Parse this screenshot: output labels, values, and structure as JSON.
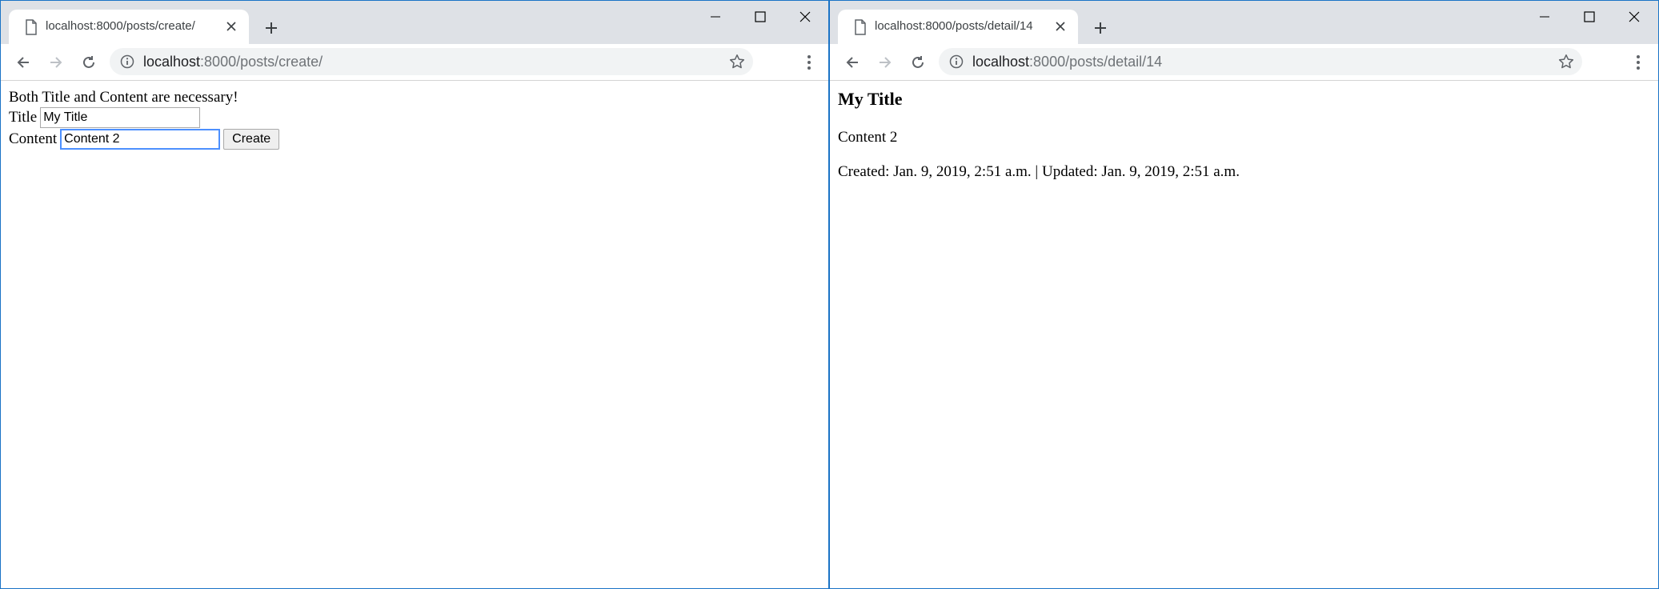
{
  "left": {
    "tab_title": "localhost:8000/posts/create/",
    "url_host": "localhost",
    "url_path": ":8000/posts/create/",
    "message": "Both Title and Content are necessary!",
    "title_label": "Title",
    "title_value": "My Title",
    "content_label": "Content",
    "content_value": "Content 2",
    "create_label": "Create"
  },
  "right": {
    "tab_title": "localhost:8000/posts/detail/14",
    "url_host": "localhost",
    "url_path": ":8000/posts/detail/14",
    "post_title": "My Title",
    "post_content": "Content 2",
    "post_meta": "Created: Jan. 9, 2019, 2:51 a.m. | Updated: Jan. 9, 2019, 2:51 a.m."
  },
  "icons": [
    "page-icon",
    "close-icon",
    "plus-icon",
    "minimize-icon",
    "maximize-icon",
    "window-close-icon",
    "back-arrow-icon",
    "forward-arrow-icon",
    "reload-icon",
    "info-icon",
    "star-icon",
    "kebab-menu-icon"
  ],
  "colors": {
    "tabbar": "#dee1e6",
    "omnibox": "#f1f3f4",
    "window_border": "#1a73c6",
    "focus": "#4d90fe"
  }
}
